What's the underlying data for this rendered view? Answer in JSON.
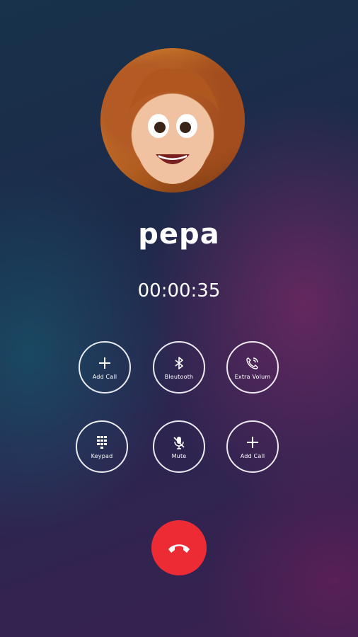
{
  "call": {
    "contact_name": "pepa",
    "duration": "00:00:35"
  },
  "controls": {
    "row1": [
      {
        "label": "Add Call",
        "icon": "plus-icon"
      },
      {
        "label": "Bleutooth",
        "icon": "bluetooth-icon"
      },
      {
        "label": "Extra Volum",
        "icon": "phone-volume-icon"
      }
    ],
    "row2": [
      {
        "label": "Keypad",
        "icon": "keypad-icon"
      },
      {
        "label": "Mute",
        "icon": "mic-off-icon"
      },
      {
        "label": "Add Call",
        "icon": "plus-icon"
      }
    ]
  },
  "end_call": {
    "icon": "end-call-icon",
    "color": "#ec2b35"
  }
}
